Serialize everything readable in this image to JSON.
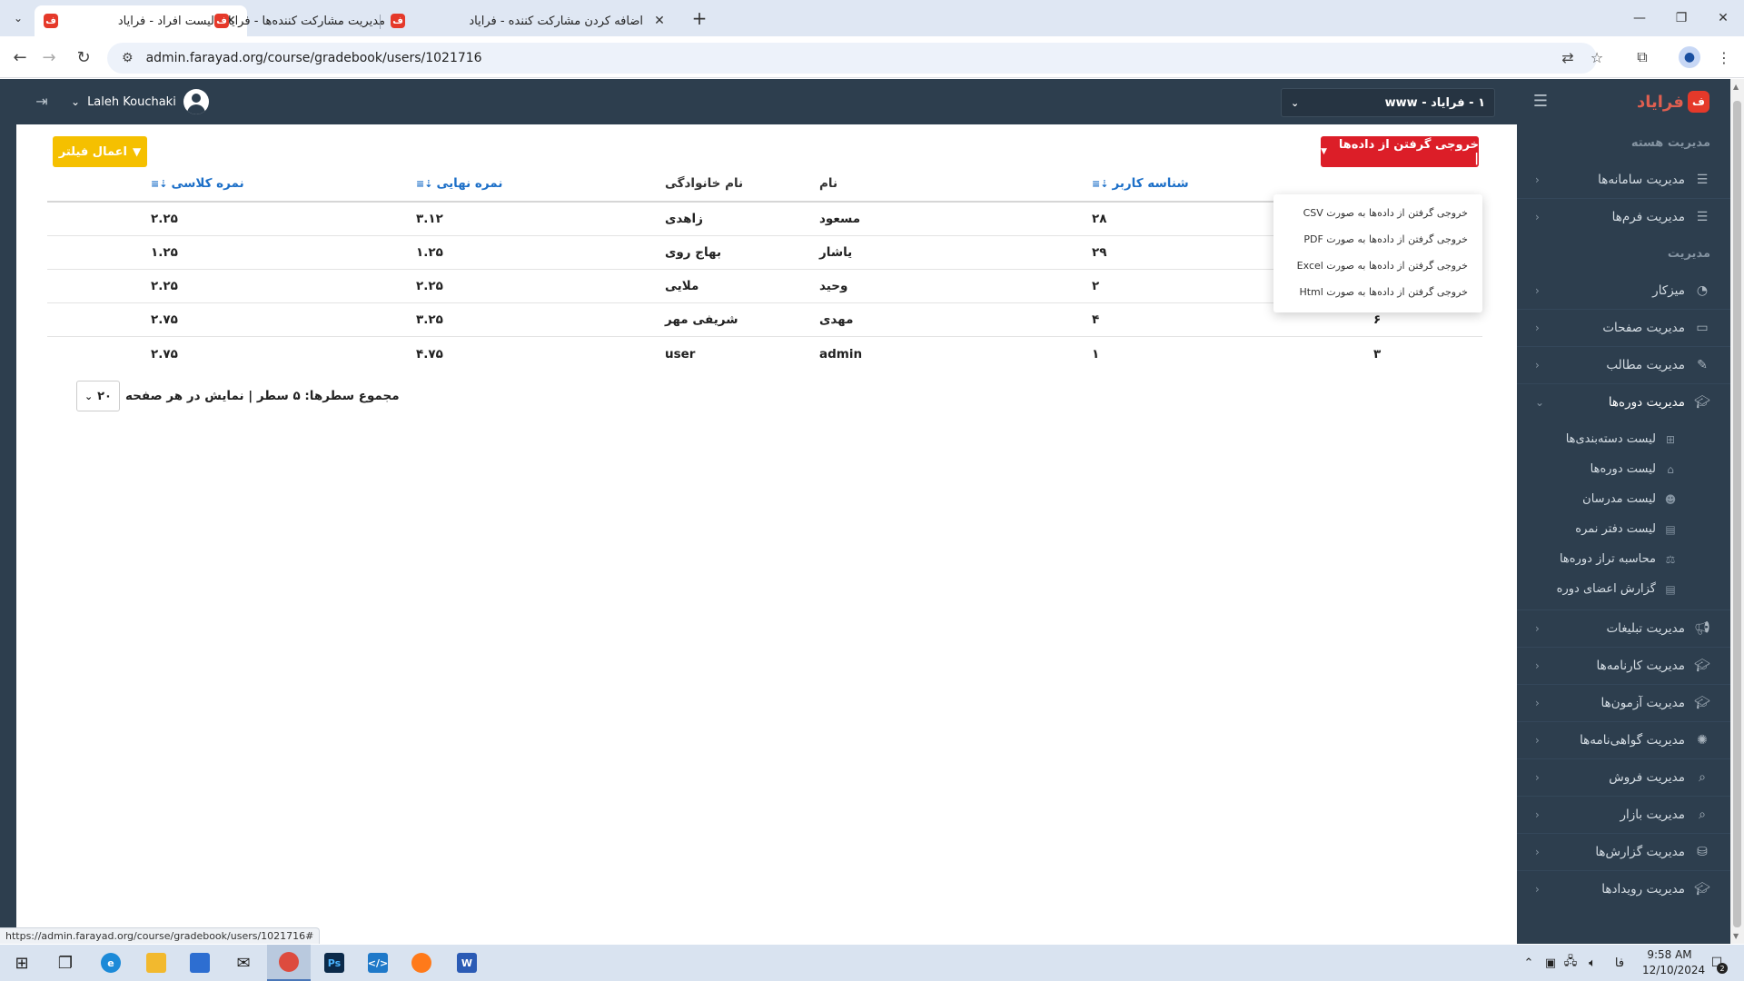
{
  "browser": {
    "tabs": [
      {
        "title": "لیست افراد - فراياد",
        "active": true
      },
      {
        "title": "مدیریت مشارکت کننده‌ها - فراياد",
        "active": false
      },
      {
        "title": "اضافه کردن مشارکت کننده - فراياد",
        "active": false
      }
    ],
    "new_tab_glyph": "+",
    "url": "admin.farayad.org/course/gradebook/users/1021716",
    "status_url": "https://admin.farayad.org/course/gradebook/users/1021716#"
  },
  "header": {
    "user_name": "Laleh Kouchaki",
    "org_select": "۱ - فراياد - www",
    "brand": "فراياد",
    "brand_mark": "ف"
  },
  "sidebar": {
    "heading_core": "مدیریت هسته",
    "heading_admin": "مدیریت",
    "items_core": [
      {
        "label": "مدیریت سامانه‌ها",
        "icon": "list-icon"
      },
      {
        "label": "مدیریت فرم‌ها",
        "icon": "list-icon"
      }
    ],
    "items_admin": [
      {
        "label": "میزکار",
        "icon": "dashboard-icon"
      },
      {
        "label": "مدیریت صفحات",
        "icon": "file-icon"
      },
      {
        "label": "مدیریت مطالب",
        "icon": "edit-icon"
      },
      {
        "label": "مدیریت دوره‌ها",
        "icon": "graduation-cap-icon"
      }
    ],
    "sub_items": [
      {
        "label": "لیست دسته‌بندی‌ها",
        "icon": "sitemap-icon"
      },
      {
        "label": "لیست دوره‌ها",
        "icon": "institution-icon"
      },
      {
        "label": "لیست مدرسان",
        "icon": "users-icon"
      },
      {
        "label": "لیست دفتر نمره",
        "icon": "chart-icon"
      },
      {
        "label": "محاسبه تراز دوره‌ها",
        "icon": "balance-icon"
      },
      {
        "label": "گزارش اعضای دوره",
        "icon": "chart-icon"
      }
    ],
    "items_more": [
      {
        "label": "مدیریت تبلیغات",
        "icon": "bullhorn-icon"
      },
      {
        "label": "مدیریت کارنامه‌ها",
        "icon": "graduation-cap-icon"
      },
      {
        "label": "مدیریت آزمون‌ها",
        "icon": "graduation-cap-icon"
      },
      {
        "label": "مدیریت گواهی‌نامه‌ها",
        "icon": "certificate-icon"
      },
      {
        "label": "مدیریت فروش",
        "icon": "search-icon"
      },
      {
        "label": "مدیریت بازار",
        "icon": "search-icon"
      },
      {
        "label": "مدیریت گزارش‌ها",
        "icon": "database-icon"
      },
      {
        "label": "مدیریت رویدادها",
        "icon": "graduation-cap-icon"
      }
    ]
  },
  "toolbar": {
    "filter_label": "اعمال فیلتر",
    "export_label": "خروجی گرفتن از داده‌ها |"
  },
  "export_menu": [
    "خروجی گرفتن از داده‌ها به صورت CSV",
    "خروجی گرفتن از داده‌ها به صورت PDF",
    "خروجی گرفتن از داده‌ها به صورت Excel",
    "خروجی گرفتن از داده‌ها به صورت Html"
  ],
  "table": {
    "headers": {
      "user_id": "شناسه کاربر",
      "first_name": "نام",
      "last_name": "نام خانوادگی",
      "final_grade": "نمره نهایی",
      "class_grade": "نمره کلاسی"
    },
    "rows": [
      {
        "c1": "",
        "user_id": "۲۸",
        "first_name": "مسعود",
        "last_name": "زاهدی",
        "final_grade": "۳.۱۲",
        "class_grade": "۲.۲۵"
      },
      {
        "c1": "",
        "user_id": "۲۹",
        "first_name": "یاشار",
        "last_name": "بهاج روی",
        "final_grade": "۱.۲۵",
        "class_grade": "۱.۲۵"
      },
      {
        "c1": "",
        "user_id": "۲",
        "first_name": "وحید",
        "last_name": "ملایی",
        "final_grade": "۲.۲۵",
        "class_grade": "۲.۲۵"
      },
      {
        "c1": "۶",
        "user_id": "۴",
        "first_name": "مهدی",
        "last_name": "شریفی مهر",
        "final_grade": "۳.۲۵",
        "class_grade": "۲.۷۵"
      },
      {
        "c1": "۳",
        "user_id": "۱",
        "first_name": "admin",
        "last_name": "user",
        "final_grade": "۴.۷۵",
        "class_grade": "۲.۷۵"
      }
    ]
  },
  "pager": {
    "text": "مجموع سطرها: ۵ سطر | نمایش در هر صفحه",
    "page_size": "۲۰"
  },
  "taskbar": {
    "time": "9:58 AM",
    "date": "12/10/2024",
    "lang": "فا",
    "notifications": "2"
  },
  "colors": {
    "sidebar_bg": "#2d3e4e",
    "export_red": "#dc1e28",
    "filter_yellow": "#f5c000",
    "link_blue": "#1e70c8"
  }
}
